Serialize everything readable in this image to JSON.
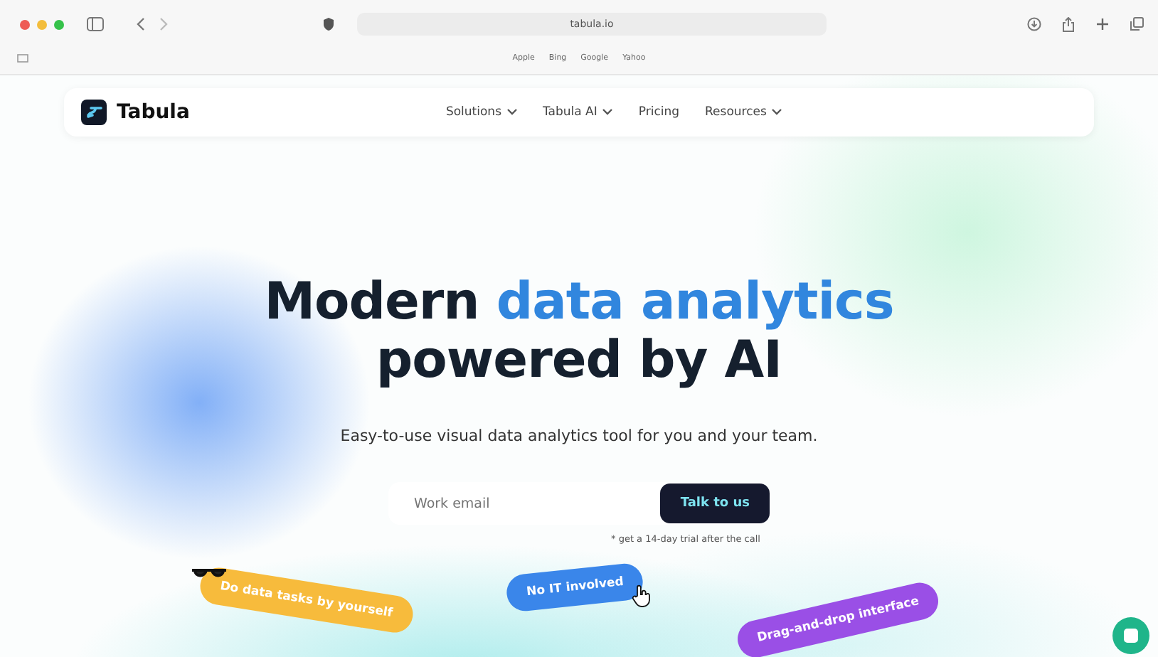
{
  "browser": {
    "address": "tabula.io",
    "favorites": [
      "Apple",
      "Bing",
      "Google",
      "Yahoo"
    ]
  },
  "nav": {
    "brand": "Tabula",
    "links": [
      {
        "label": "Solutions",
        "dropdown": true
      },
      {
        "label": "Tabula AI",
        "dropdown": true
      },
      {
        "label": "Pricing",
        "dropdown": false
      },
      {
        "label": "Resources",
        "dropdown": true
      }
    ]
  },
  "hero": {
    "title_plain": "Modern",
    "title_accent": "data analytics",
    "title_line2": "powered by AI",
    "subtitle": "Easy-to-use visual data analytics tool for you and your team.",
    "email_placeholder": "Work email",
    "cta": "Talk to us",
    "note": "* get a 14-day trial after the call"
  },
  "pills": [
    {
      "label": "Do data tasks by yourself",
      "color": "#f7bb3c"
    },
    {
      "label": "No IT involved",
      "color": "#3a86ea"
    },
    {
      "label": "Drag-and-drop interface",
      "color": "#9a4fe6"
    }
  ]
}
